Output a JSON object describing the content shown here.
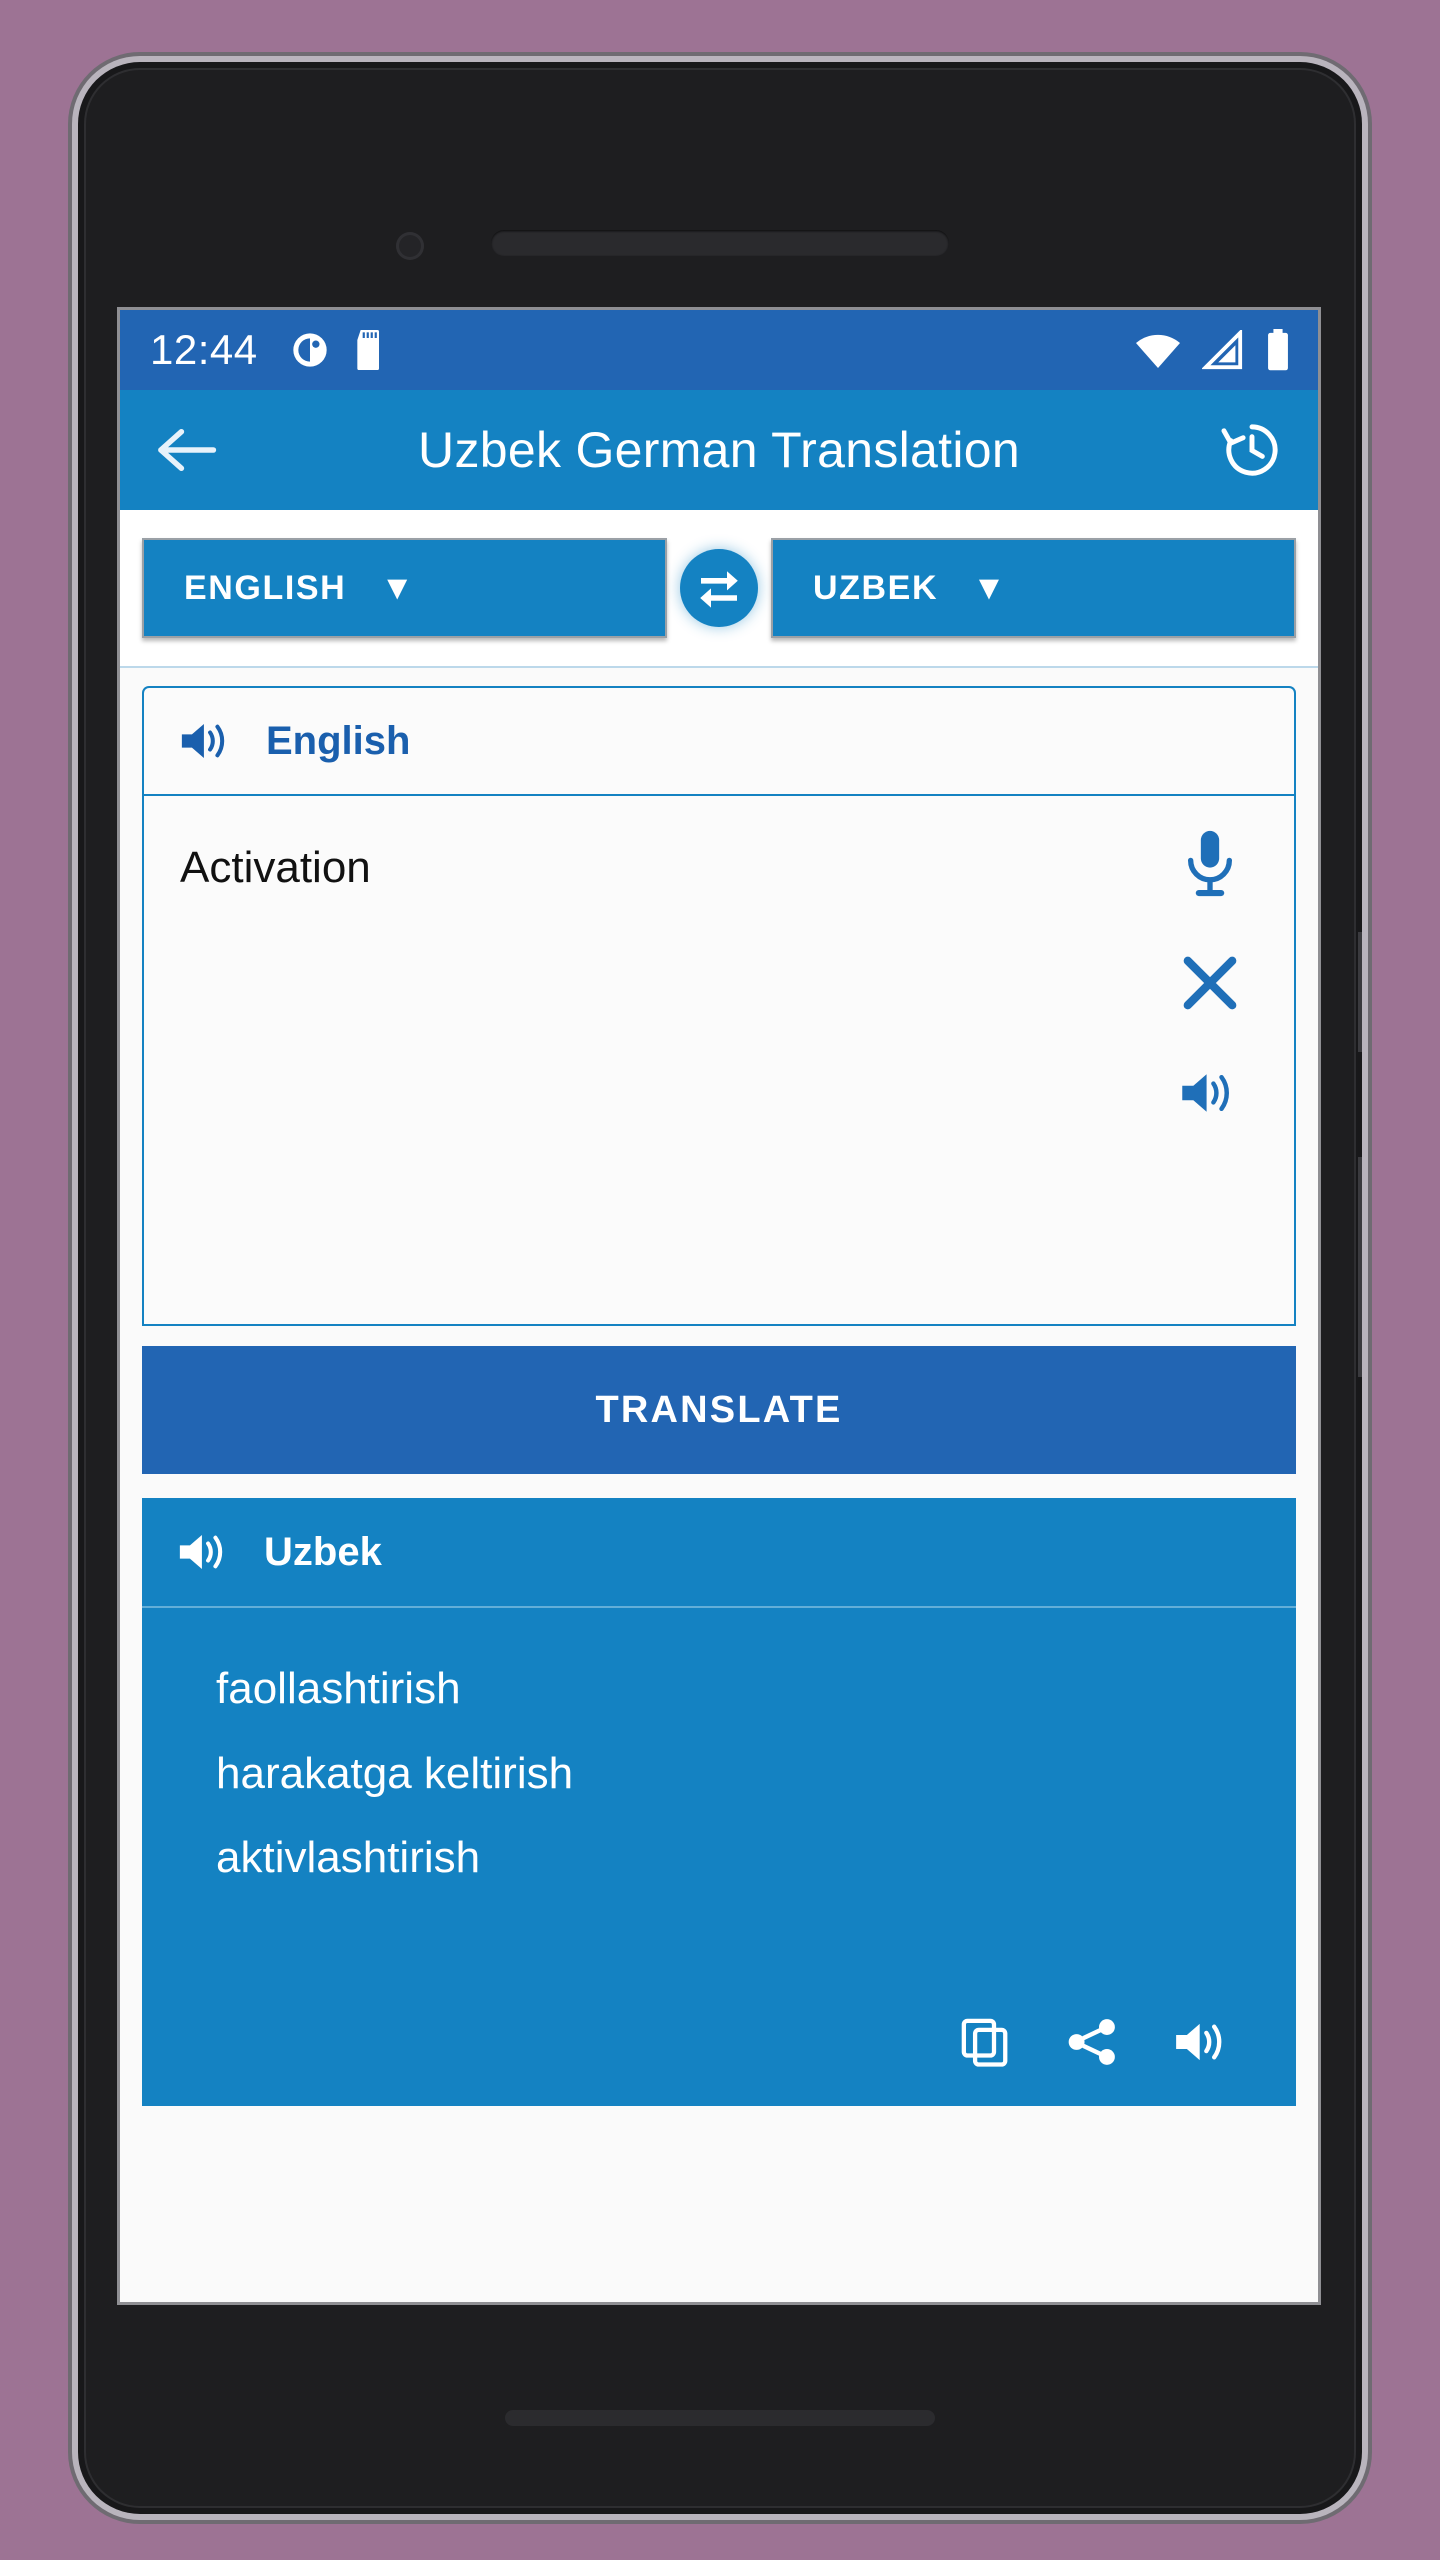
{
  "status_bar": {
    "time": "12:44",
    "left_icons": [
      "alarm-clock-icon",
      "sd-card-icon"
    ],
    "right_icons": [
      "wifi-icon",
      "cellular-signal-icon",
      "battery-icon"
    ],
    "background_color": "#2265b3"
  },
  "app_bar": {
    "back_label": "back-arrow-icon",
    "title": "Uzbek German Translation",
    "history_label": "history-icon",
    "background_color": "#1482c2"
  },
  "language_selector": {
    "source": {
      "label": "ENGLISH",
      "caret": "▼"
    },
    "swap": "swap-horizontal-icon",
    "target": {
      "label": "UZBEK",
      "caret": "▼"
    }
  },
  "source_card": {
    "header_label": "English",
    "speaker_icon": "speaker-icon",
    "input_text": "Activation",
    "input_placeholder": "",
    "actions": [
      {
        "name": "microphone-icon",
        "label": "Voice input"
      },
      {
        "name": "clear-icon",
        "label": "Clear"
      },
      {
        "name": "speaker-icon",
        "label": "Speak"
      }
    ]
  },
  "translate_button": {
    "label": "TRANSLATE",
    "color": "#2265b3"
  },
  "result_card": {
    "header_label": "Uzbek",
    "speaker_icon": "speaker-icon",
    "background_color": "#1482c2",
    "translations": [
      "faollashtirish",
      "harakatga keltirish",
      "aktivlashtirish"
    ],
    "actions": [
      {
        "name": "copy-icon",
        "label": "Copy"
      },
      {
        "name": "share-icon",
        "label": "Share"
      },
      {
        "name": "speaker-icon",
        "label": "Speak"
      }
    ]
  },
  "theme": {
    "page_background": "#9d7394",
    "primary": "#1482c2",
    "primary_dark": "#2265b3",
    "text_on_primary": "#ffffff"
  }
}
